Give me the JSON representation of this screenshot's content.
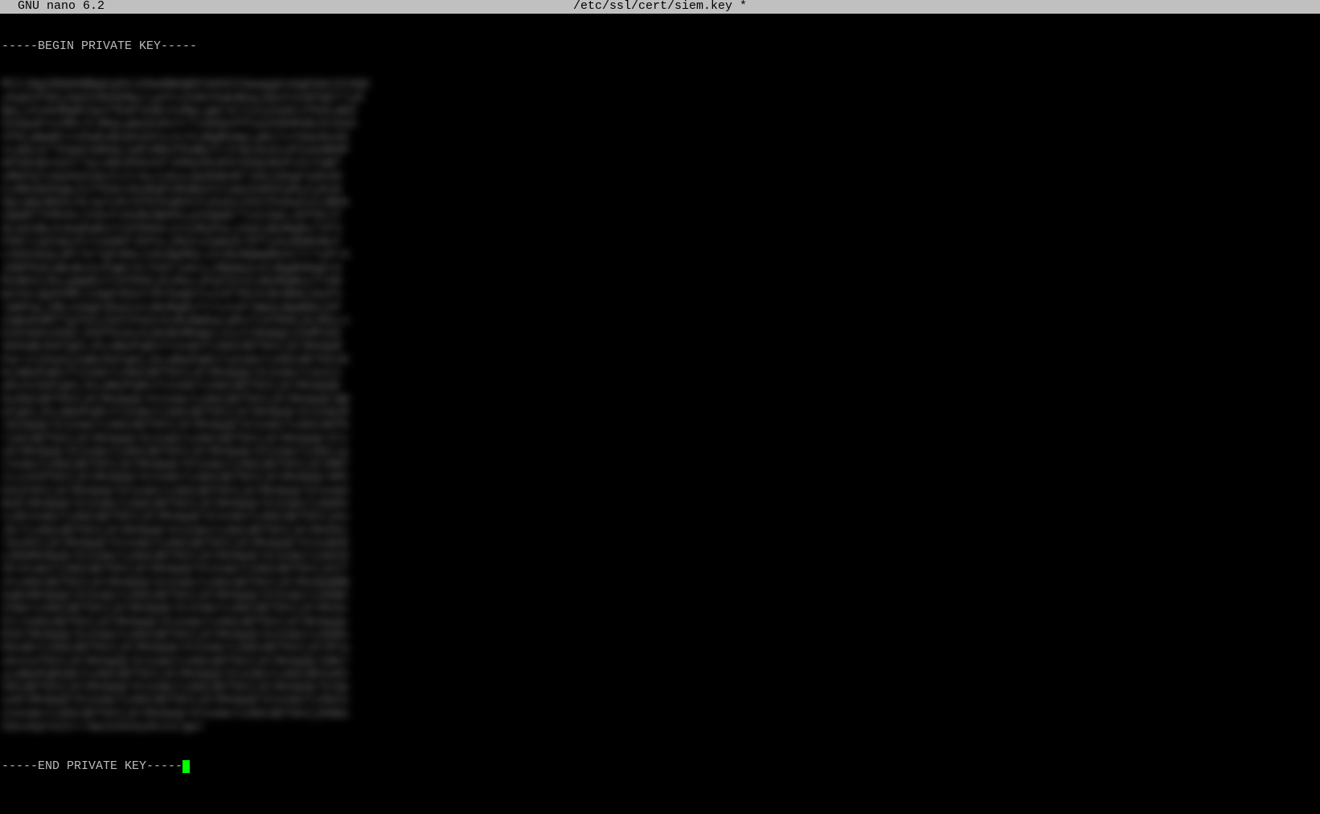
{
  "titlebar": {
    "app_name": "  GNU nano 6.2",
    "file_path": "/etc/ssl/cert/siem.key *"
  },
  "content": {
    "begin_marker": "-----BEGIN PRIVATE KEY-----",
    "end_marker": "-----END PRIVATE KEY-----",
    "key_lines": [
      "MIIJQgIBADANBgkqhkiG9w0BAQEFAASCCSwwggkoAgEAAoICAQC",
      "cKqOvF0AjXmZVXKhEMq+LpXYs3nRtPwKdKqLm9xF4vNfQhT7yD",
      "BpLzXvHnMqRtGwYfKdF3nBcVxMpLqWrStYuIoZaGhJfKdLmN3",
      "9zKpwFnxXMvJt3RqLpWxDsKnYrTzGbQvPfCaZeHkMnBvXcDaS",
      "3fKLmNqRtYxPwDvBsGhZkFeJn7CvBgMnHpLqRxTsYkWzNvA5",
      "vLmDcXrTkGpFeNhQzJwPxMbVfKdBsYrZtNc0uG1oP2aSdR9P",
      "mFkNzBxVqYrTpLeWcDhGnSfJkMaZ8xR4tGhQvNoPzXsYwB7",
      "nMkPqTxGwVbZnDcFsYrHuJiKoL0p9O8nM7lK6jH5gF4dS39",
      "CzNbVmXkQwJsYfKdLhGnRqPzMnBaVtCxWsZeRoFpHuIyKoH",
      "OpLmQzNbXcVkJwYsHrGfDtEqR4tFyGuHjIkOlPaSwZxCvBEK",
      "oQwRtYhMxKvJzDcFsGnBvNmXkLpZaQwErTyUiOpLsDfGhJY",
      "9LmZnBcXvKqPwRsYtGfDhEkJnIoMuPaLzXwCvBnMqRsT3f3",
      "FbKrLmZnQxVtYsGdHfJkPoLiMuCxZaWsErDfTyGvHbNnNoY",
      "cVmXnKqLwPrStYgFdHeJzKoNpMaLxZcBvNmWqReStTrYuPrA",
      "JONfKdLmNzBvXcPqWrStYhGfJeKiLoMpNaZxCvBgNhRqEtG",
      "MzNbVcXkLpQwRsYtGfDhEjKiMoLuPaChZxCvBnMqResTtHH",
      "WzXeLQpOnMkJiHgFdSaYtRrEwQnYuIoPlMzXcBvNbKjHuFh",
      "lmKPqLiMkJnHgFdSaZxCvBnMqRsTtYuIoPlNmXcBwNbKjHf",
      "2qWsEdRfTgYhUjIkOlPaSzXcBvNmKqLwRsYtGfDhEjKiMoLn",
      "6xEVmXnZbQlJhGfDsAzXcWvBnMkQpLoIuYtReWqCzXdMlEE",
      "4mXaBcDeFgHiJkLmNoPqRsYtUvWxYzAbCdEfGhIjKlMnOpR",
      "PqrstUVwXyZaBcDeFgHiJkLmNoPqRsTuUvWxYzAbCdEfGhIK",
      "bLmNoPqRsTtUvWxYzAbCdEfGhIjKlMnOpQrStUvWxYzAzCn",
      "aKzXcDeFgHiJkLmNoPqRsYtUvWxYzAbCdEfGhIjKlMnOpQC",
      "HzAbCdEfGhIjKlMnOpQrStUvWxYzAbCdEfGhIjKlMnOpQrQW",
      "eFgHiJkLmNoPqRsTtUvWxYzAbCdEfGhIjKlMnOpQrStUvWxR",
      "lKnOpQrStUvWxYzAbCdEfGhIjKlMnOpQrStUvWxYzAbCdHfK",
      "l1bCdEfGhIjKlMnOpQrStUvWxYzAbCdEfGhIjKlMnOpQrSTz",
      "yKlMnOpQrStUvWxYzAbCdEfGhIjKlMnOpQrStUvWxYzAbCip",
      "rUvWxYzAbCdEfGhIjKlMnOpQrStUvWxYzAbCdEfGhIjKlMNY",
      "IzjnCDfGhIjKlMnOpQrStUvWxYzAbCdEfGhIjKlMnOpQrSMI",
      "bXyFGhIjKlMnOpQrStUvWxYzAbCdEfGhIjKlMnOpQrStUvW4",
      "NoKlMnOpQrStUvWxYzAbCdEfGhIjKlMnOpQrStUvWxYzAbM1",
      "1xNtUvWxYzAbCdEfGhIjKlMnOpQrStUvWxYzAbCdEfGhIjKo",
      "JKlYzAbCdEfGhIjKlMnOpQrStUvWxYzAbCdEfGhIjKlMnOXc",
      "l0zGhIjKlMnOpQrStUvWxYzAbCdEfGhIjKlMnOpQrStUvWZK",
      "cXKbMnOpQrStUvWxYzAbCdEfGhIjKlMnOpQrStUvWxYzAbCD",
      "3FxhvWxYzAbCdEfGhIjKlMnOpQrStUvWxYzAbCdEfGhIjKIT",
      "4YzAbCdEfGhIjKlMnOpQrStUvWxYzAbCdEfGhIjKlMnOpQRB",
      "5qKoMnOpQrStUvWxYzAbCdEfGhIjKlMnOpQrStUvWxYzAbBC",
      "2VWxYzAbCdEfGhIjKlMnOpQrStUvWxYzAbCdEfGhIjKlMnOc",
      "5YrS4bCdEfGhIjKlMnOpQrStUvWxYzAbCdEfGhIjKlMnOpQc",
      "RIKlMnOpQrStUvWxYzAbCdEfGhIjKlMnOpQrStUvWxYzAbBs",
      "DGxWnYzAbCdEfGhIjKlMnOpQrStUvWxYzAbCdEfGhIjKlM7w",
      "oKxCefGhIjKlMnOpQrStUvWxYzAbCdEfGhIjKlMnOpQrS8K7",
      "yLmNoPqRsWxYzAbCdEfGhIjKlMnOpQrStUvWxYzAbCdESoRI",
      "2bCdEfGhIjKlMnOpQrStUvWxYzAbCdEfGhIjKlMnOpQrSt8p",
      "seKlMnOpQrStUvWxYzAbCdEfGhIjKlMnOpQrStUvWxYzAbCe",
      "2sUvWxYzAbCdEfGhIjKlMnOpQrStUvWxYzAbCdEfGhIjK0Wo",
      "CmxobpYaIn+/mwikdsAyACvurgw="
    ]
  }
}
